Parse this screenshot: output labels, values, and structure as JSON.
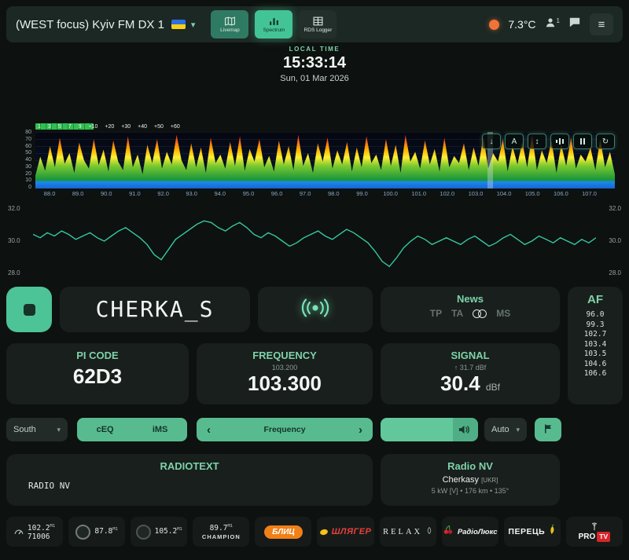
{
  "header": {
    "title": "(WEST focus) Kyiv FM DX 1",
    "nav": [
      {
        "label": "Livemap"
      },
      {
        "label": "Spectrum"
      },
      {
        "label": "RDS Logger"
      }
    ],
    "temperature": "7.3°C",
    "users_count": "1"
  },
  "clock": {
    "label": "LOCAL TIME",
    "time": "15:33:14",
    "date": "Sun, 01 Mar 2026"
  },
  "chart_data": [
    {
      "type": "area",
      "name": "fm-band-spectrum",
      "ylim": [
        0,
        80
      ],
      "xlim": [
        87.5,
        107.9
      ],
      "y_ticks": [
        "80",
        "70",
        "60",
        "50",
        "40",
        "30",
        "20",
        "10",
        "0"
      ],
      "x_ticks": [
        "88.0",
        "89.0",
        "90.0",
        "91.0",
        "92.0",
        "93.0",
        "94.0",
        "95.0",
        "96.0",
        "97.0",
        "98.0",
        "99.0",
        "100.0",
        "101.0",
        "102.0",
        "103.0",
        "104.0",
        "105.0",
        "106.0",
        "107.0"
      ],
      "top_scale": [
        "1",
        "3",
        "5",
        "7",
        "9",
        "+10",
        "+20",
        "+30",
        "+40",
        "+50",
        "+60"
      ],
      "tuned_mhz": 103.3,
      "values": [
        18,
        45,
        25,
        60,
        30,
        72,
        35,
        50,
        22,
        65,
        40,
        28,
        70,
        33,
        55,
        24,
        68,
        38,
        26,
        74,
        30,
        48,
        20,
        62,
        36,
        70,
        28,
        52,
        34,
        76,
        40,
        26,
        64,
        30,
        58,
        22,
        72,
        36,
        48,
        28,
        66,
        32,
        74,
        25,
        56,
        38,
        70,
        30,
        46,
        24,
        68,
        34,
        60,
        26,
        76,
        32,
        50,
        22,
        64,
        38,
        72,
        28,
        54,
        34,
        66,
        24,
        58,
        30,
        74,
        36,
        48,
        26,
        70,
        32,
        62,
        22,
        76,
        38,
        52,
        28,
        68,
        34,
        56,
        24,
        72,
        30,
        46,
        36,
        64,
        26,
        58,
        32,
        74,
        28,
        50,
        38,
        70,
        24,
        60,
        34,
        66,
        30,
        76,
        26,
        54,
        36,
        68,
        22,
        62,
        32,
        72,
        28,
        48,
        38,
        58,
        26,
        70,
        30,
        52,
        20
      ]
    },
    {
      "type": "line",
      "name": "signal-history",
      "ylim": [
        28,
        32
      ],
      "y_ticks": [
        "32.0",
        "30.0",
        "28.0"
      ],
      "values": [
        30.4,
        30.2,
        30.5,
        30.3,
        30.6,
        30.4,
        30.1,
        30.3,
        30.5,
        30.2,
        30.0,
        30.3,
        30.6,
        30.8,
        30.5,
        30.2,
        29.8,
        29.2,
        28.9,
        29.5,
        30.1,
        30.4,
        30.7,
        31.0,
        31.2,
        31.1,
        30.8,
        30.6,
        30.9,
        31.1,
        30.8,
        30.4,
        30.2,
        30.5,
        30.3,
        30.0,
        29.7,
        29.9,
        30.2,
        30.4,
        30.6,
        30.3,
        30.1,
        30.4,
        30.7,
        30.5,
        30.2,
        29.9,
        29.4,
        28.8,
        28.5,
        29.0,
        29.6,
        30.0,
        30.3,
        30.1,
        29.8,
        30.0,
        30.2,
        30.0,
        29.8,
        30.1,
        30.3,
        30.0,
        29.7,
        29.9,
        30.2,
        30.4,
        30.1,
        29.8,
        30.0,
        30.3,
        30.1,
        29.9,
        30.2,
        30.0,
        29.8,
        30.1,
        29.9,
        30.2
      ]
    }
  ],
  "rds": {
    "ps": "CHERKA_S",
    "pi": {
      "label": "PI CODE",
      "value": "62D3"
    },
    "frequency": {
      "label": "FREQUENCY",
      "sub": "103.200",
      "value": "103.300"
    },
    "signal": {
      "label": "SIGNAL",
      "peak": "31.7 dBf",
      "value": "30.4",
      "unit": "dBf"
    },
    "flags": {
      "title": "News",
      "tp": "TP",
      "ta": "TA",
      "ms": "MS"
    },
    "af": {
      "title": "AF",
      "list": [
        "96.0",
        "99.3",
        "102.7",
        "103.4",
        "103.5",
        "104.6",
        "106.6"
      ]
    },
    "radiotext": {
      "title": "RADIOTEXT",
      "text": "RADIO NV"
    },
    "station": {
      "name": "Radio NV",
      "location": "Cherkasy",
      "country": "[UKR]",
      "details": "5 kW [V] • 176 km • 135°"
    }
  },
  "tuner": {
    "antenna": "South",
    "eq_label": "cEQ",
    "ims_label": "iMS",
    "step_label": "Frequency",
    "mode": "Auto"
  },
  "presets": [
    {
      "freq": "102.2",
      "badge": "M1",
      "code": "71006"
    },
    {
      "freq": "87.8",
      "badge": "M1"
    },
    {
      "freq": "105.2",
      "badge": "M1"
    },
    {
      "freq": "89.7",
      "badge": "M1",
      "name": "CHAMPION"
    },
    {
      "name": "БЛИЦ"
    },
    {
      "name": "ШЛЯГЕР"
    },
    {
      "name": "RELAX"
    },
    {
      "name": "РадіоЛюкс"
    },
    {
      "name": "ПЕРЕЦЬ"
    },
    {
      "name": "PRO",
      "suffix": "TV"
    }
  ],
  "icons": {
    "menu": "≡",
    "chevron_down": "▾",
    "prev": "‹",
    "next": "›",
    "up_arrow": "↑",
    "download": "↓",
    "autoscale": "A",
    "updown": "↕",
    "refresh": "↻"
  }
}
